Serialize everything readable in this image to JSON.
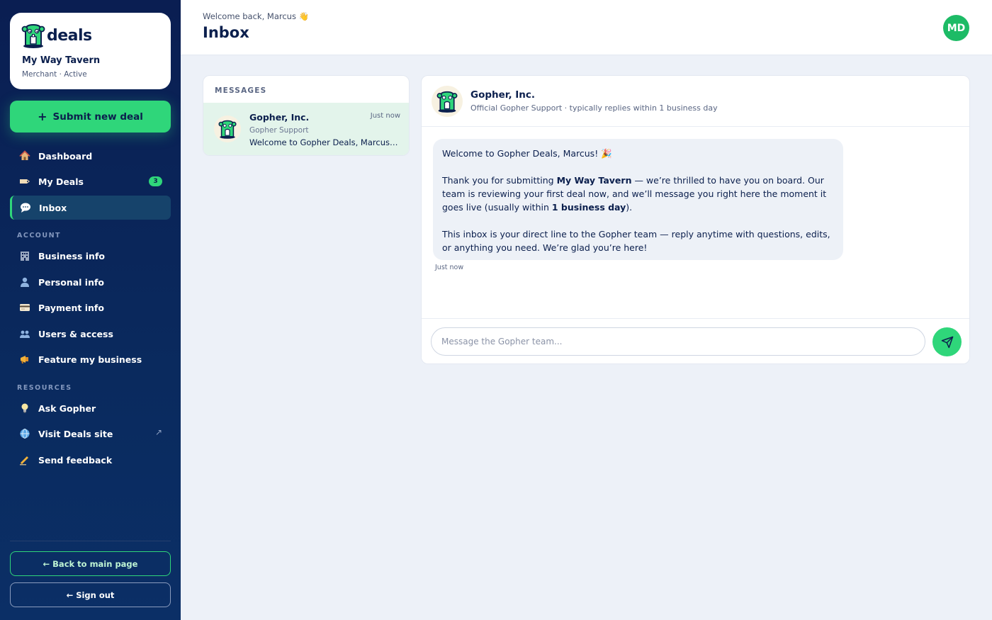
{
  "brand": {
    "logo_text": "deals",
    "business_name": "My Way Tavern",
    "business_status": "Merchant · Active"
  },
  "sidebar": {
    "submit_label": "Submit new deal",
    "nav": [
      {
        "label": "Dashboard",
        "icon": "house-icon"
      },
      {
        "label": "My Deals",
        "icon": "tag-icon",
        "badge": "3"
      },
      {
        "label": "Inbox",
        "icon": "speech-bubble-icon",
        "active": true
      }
    ],
    "account_title": "ACCOUNT",
    "account": [
      {
        "label": "Business info",
        "icon": "building-icon"
      },
      {
        "label": "Personal info",
        "icon": "person-icon"
      },
      {
        "label": "Payment info",
        "icon": "credit-card-icon"
      },
      {
        "label": "Users & access",
        "icon": "people-icon"
      },
      {
        "label": "Feature my business",
        "icon": "megaphone-icon"
      }
    ],
    "resources_title": "RESOURCES",
    "resources": [
      {
        "label": "Ask Gopher",
        "icon": "lightbulb-icon"
      },
      {
        "label": "Visit Deals site",
        "icon": "globe-icon",
        "external": "↗"
      },
      {
        "label": "Send feedback",
        "icon": "pencil-icon"
      }
    ],
    "back_label": "← Back to main page",
    "signout_label": "← Sign out"
  },
  "header": {
    "welcome": "Welcome back, Marcus 👋",
    "title": "Inbox",
    "avatar_initials": "MD"
  },
  "messages": {
    "title": "MESSAGES",
    "items": [
      {
        "name": "Gopher, Inc.",
        "time": "Just now",
        "sender": "Gopher Support",
        "preview": "Welcome to Gopher Deals, Marcus! 🎉"
      }
    ]
  },
  "conversation": {
    "name": "Gopher, Inc.",
    "subtitle": "Official Gopher Support · typically replies within 1 business day",
    "message": {
      "line1": "Welcome to Gopher Deals, Marcus! 🎉",
      "p2_a": "Thank you for submitting ",
      "p2_b": "My Way Tavern",
      "p2_c": " — we’re thrilled to have you on board. Our team is reviewing your first deal now, and we’ll message you right here the moment it goes live (usually within ",
      "p2_d": "1 business day",
      "p2_e": ").",
      "p3": "This inbox is your direct line to the Gopher team — reply anytime with questions, edits, or anything you need. We’re glad you’re here!",
      "time": "Just now"
    },
    "composer_placeholder": "Message the Gopher team..."
  },
  "colors": {
    "accent": "#2fd67a",
    "sidebar_bg": "#0a1e52",
    "navy_text": "#0b1f4d",
    "avatar_bg": "#1dbb66"
  }
}
